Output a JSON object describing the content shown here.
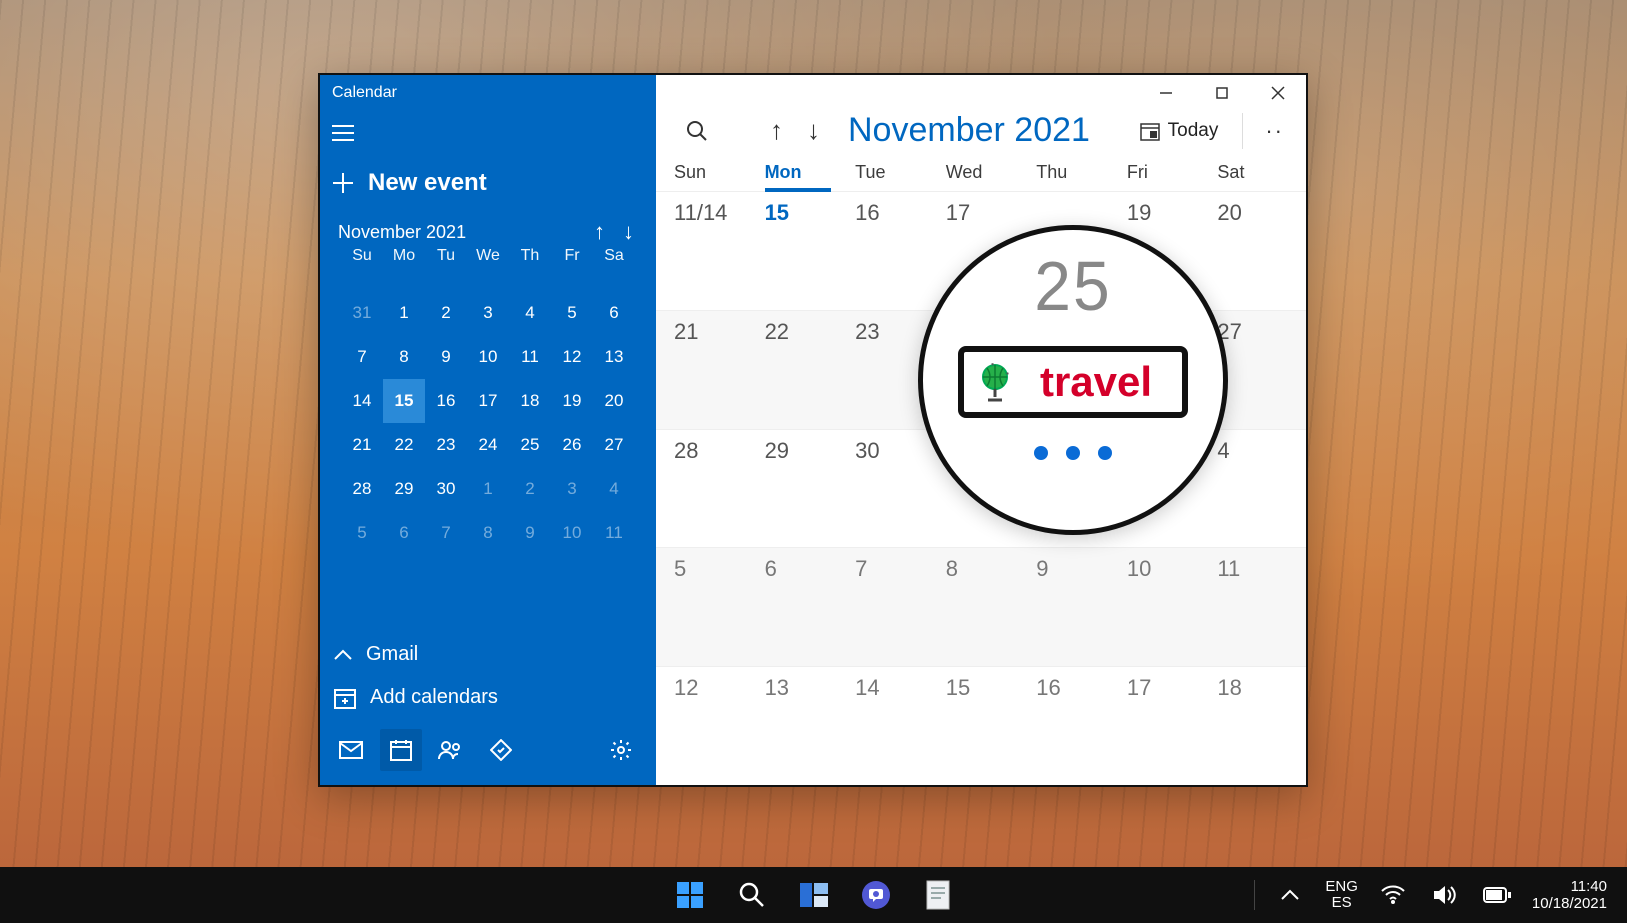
{
  "window": {
    "title": "Calendar"
  },
  "sidebar": {
    "new_event_label": "New event",
    "mini_cal": {
      "title": "November 2021",
      "dow": [
        "Su",
        "Mo",
        "Tu",
        "We",
        "Th",
        "Fr",
        "Sa"
      ],
      "days": [
        {
          "n": "31",
          "faded": true
        },
        {
          "n": "1"
        },
        {
          "n": "2"
        },
        {
          "n": "3"
        },
        {
          "n": "4"
        },
        {
          "n": "5"
        },
        {
          "n": "6"
        },
        {
          "n": "7"
        },
        {
          "n": "8"
        },
        {
          "n": "9"
        },
        {
          "n": "10"
        },
        {
          "n": "11"
        },
        {
          "n": "12"
        },
        {
          "n": "13"
        },
        {
          "n": "14"
        },
        {
          "n": "15",
          "sel": true
        },
        {
          "n": "16"
        },
        {
          "n": "17"
        },
        {
          "n": "18"
        },
        {
          "n": "19"
        },
        {
          "n": "20"
        },
        {
          "n": "21"
        },
        {
          "n": "22"
        },
        {
          "n": "23"
        },
        {
          "n": "24"
        },
        {
          "n": "25"
        },
        {
          "n": "26"
        },
        {
          "n": "27"
        },
        {
          "n": "28"
        },
        {
          "n": "29"
        },
        {
          "n": "30"
        },
        {
          "n": "1",
          "faded": true
        },
        {
          "n": "2",
          "faded": true
        },
        {
          "n": "3",
          "faded": true
        },
        {
          "n": "4",
          "faded": true
        },
        {
          "n": "5",
          "faded": true
        },
        {
          "n": "6",
          "faded": true
        },
        {
          "n": "7",
          "faded": true
        },
        {
          "n": "8",
          "faded": true
        },
        {
          "n": "9",
          "faded": true
        },
        {
          "n": "10",
          "faded": true
        },
        {
          "n": "11",
          "faded": true
        }
      ]
    },
    "account_label": "Gmail",
    "add_calendars_label": "Add calendars"
  },
  "main": {
    "title": "November 2021",
    "today_label": "Today",
    "dow": [
      "Sun",
      "Mon",
      "Tue",
      "Wed",
      "Thu",
      "Fri",
      "Sat"
    ],
    "today_index": 1,
    "weeks": [
      [
        {
          "n": "11/14"
        },
        {
          "n": "15",
          "today": true
        },
        {
          "n": "16"
        },
        {
          "n": "17"
        },
        {
          "n": ""
        },
        {
          "n": "19"
        },
        {
          "n": "20"
        }
      ],
      [
        {
          "n": "21"
        },
        {
          "n": "22"
        },
        {
          "n": "23"
        },
        {
          "n": ""
        },
        {
          "n": ""
        },
        {
          "n": ""
        },
        {
          "n": "27"
        }
      ],
      [
        {
          "n": "28"
        },
        {
          "n": "29"
        },
        {
          "n": "30"
        },
        {
          "n": ""
        },
        {
          "n": ""
        },
        {
          "n": ""
        },
        {
          "n": "4"
        }
      ],
      [
        {
          "n": "5",
          "dim": true
        },
        {
          "n": "6",
          "dim": true
        },
        {
          "n": "7",
          "dim": true
        },
        {
          "n": "8",
          "dim": true
        },
        {
          "n": "9",
          "dim": true
        },
        {
          "n": "10",
          "dim": true
        },
        {
          "n": "11",
          "dim": true
        }
      ],
      [
        {
          "n": "12",
          "dim": true
        },
        {
          "n": "13",
          "dim": true
        },
        {
          "n": "14",
          "dim": true
        },
        {
          "n": "15",
          "dim": true
        },
        {
          "n": "16",
          "dim": true
        },
        {
          "n": "17",
          "dim": true
        },
        {
          "n": "18",
          "dim": true
        }
      ]
    ]
  },
  "lens": {
    "day": "25",
    "event_label": "travel"
  },
  "taskbar": {
    "lang1": "ENG",
    "lang2": "ES",
    "time": "11:40",
    "date": "10/18/2021"
  }
}
